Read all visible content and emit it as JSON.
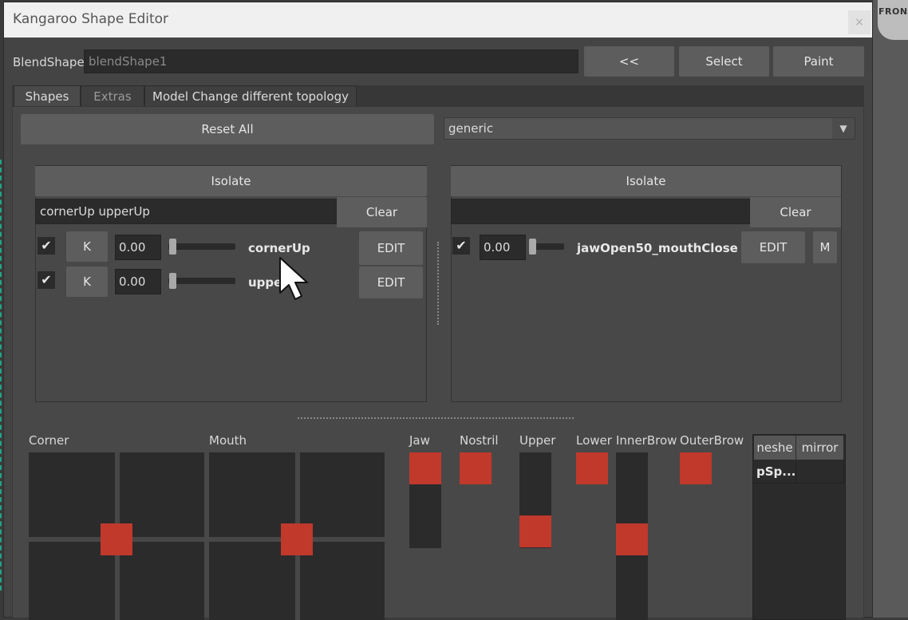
{
  "window": {
    "title": "Kangaroo Shape Editor",
    "close_glyph": "×"
  },
  "background": {
    "viewport_label": "FRON"
  },
  "blendshape": {
    "label": "BlendShape",
    "value": "blendShape1",
    "back_label": "<<",
    "select_label": "Select",
    "paint_label": "Paint"
  },
  "tabs": [
    {
      "label": "Shapes"
    },
    {
      "label": "Extras"
    },
    {
      "label": "Model Change different topology"
    }
  ],
  "shapes_tab": {
    "reset_all_label": "Reset All",
    "preset_value": "generic",
    "left_pane": {
      "isolate_label": "Isolate",
      "filter_value": "cornerUp upperUp",
      "clear_label": "Clear",
      "rows": [
        {
          "checked": "✔",
          "key_label": "K",
          "value": "0.00",
          "slider": 0,
          "name": "cornerUp",
          "edit_label": "EDIT"
        },
        {
          "checked": "✔",
          "key_label": "K",
          "value": "0.00",
          "slider": 0,
          "name": "uppe",
          "edit_label": "EDIT"
        }
      ]
    },
    "right_pane": {
      "isolate_label": "Isolate",
      "filter_value": "",
      "clear_label": "Clear",
      "rows": [
        {
          "checked": "✔",
          "value": "0.00",
          "slider": 0,
          "name": "jawOpen50_mouthClose",
          "edit_label": "EDIT",
          "mirror_label": "M"
        }
      ]
    },
    "controls": {
      "corner_label": "Corner",
      "mouth_label": "Mouth",
      "jaw_label": "Jaw",
      "nostril_label": "Nostril",
      "upper_label": "Upper",
      "lower_label": "Lower",
      "innerbrow_label": "InnerBrow",
      "outerbrow_label": "OuterBrow"
    },
    "mesh_table": {
      "headers": [
        "neshe",
        "mirror"
      ],
      "rows": [
        [
          "pSp...",
          ""
        ]
      ]
    }
  },
  "colors": {
    "handle": "#c0392b",
    "panel": "#484848",
    "field": "#2b2b2b"
  }
}
